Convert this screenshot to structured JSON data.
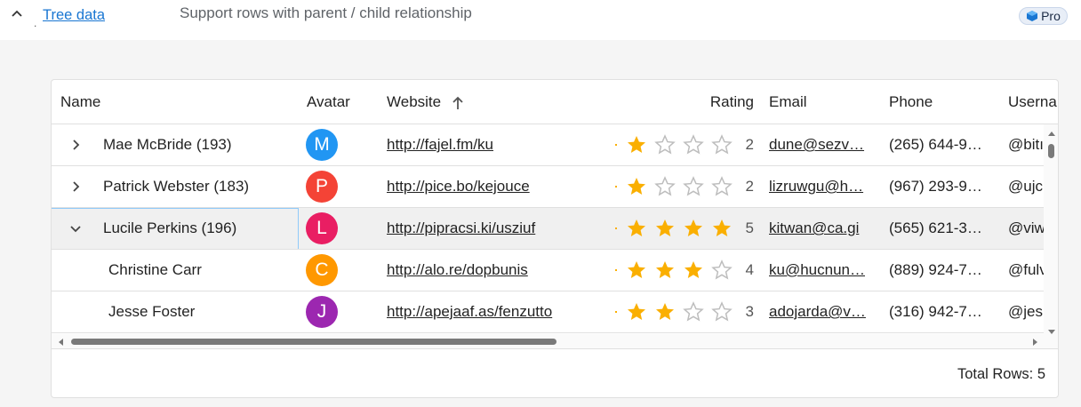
{
  "demo": {
    "marker": ".",
    "title": "Tree data",
    "description": "Support rows with parent / child relationship",
    "badge": "Pro"
  },
  "colors": {
    "link": "#1976d2",
    "star_filled": "#faaf00",
    "star_empty": "#bdbdbd"
  },
  "grid": {
    "columns": [
      {
        "key": "name",
        "label": "Name"
      },
      {
        "key": "avatar",
        "label": "Avatar"
      },
      {
        "key": "website",
        "label": "Website",
        "sort": "ascending"
      },
      {
        "key": "rating",
        "label": "Rating"
      },
      {
        "key": "email",
        "label": "Email"
      },
      {
        "key": "phone",
        "label": "Phone"
      },
      {
        "key": "username",
        "label": "Userna"
      }
    ],
    "rows": [
      {
        "name": "Mae McBride (193)",
        "expander": "chevron-right-icon",
        "avatar": "M",
        "avatar_color": "#2196f3",
        "website": "http://fajel.fm/ku",
        "rating": 1,
        "rating_label": "2",
        "email": "dune@sezv…",
        "phone": "(265) 644-9…",
        "username": "@bitı"
      },
      {
        "name": "Patrick Webster (183)",
        "expander": "chevron-right-icon",
        "avatar": "P",
        "avatar_color": "#f44336",
        "website": "http://pice.bo/kejouce",
        "rating": 1,
        "rating_label": "2",
        "email": "lizruwgu@h…",
        "phone": "(967) 293-9…",
        "username": "@ujc"
      },
      {
        "name": "Lucile Perkins (196)",
        "expander": "chevron-down-icon",
        "avatar": "L",
        "avatar_color": "#e91e63",
        "website": "http://pipracsi.ki/usziuf",
        "rating": 4,
        "rating_label": "5",
        "email": "kitwan@ca.gi",
        "phone": "(565) 621-3…",
        "username": "@viw",
        "selected": true
      },
      {
        "name": "Christine Carr",
        "avatar": "C",
        "avatar_color": "#ff9800",
        "website": "http://alo.re/dopbunis",
        "rating": 3,
        "rating_label": "4",
        "email": "ku@hucnun…",
        "phone": "(889) 924-7…",
        "username": "@fulv",
        "child": true
      },
      {
        "name": "Jesse Foster",
        "avatar": "J",
        "avatar_color": "#9c27b0",
        "website": "http://apejaaf.as/fenzutto",
        "rating": 2,
        "rating_label": "3",
        "email": "adojarda@v…",
        "phone": "(316) 942-7…",
        "username": "@jes",
        "child": true
      }
    ],
    "footer": {
      "total_rows": "Total Rows: 5"
    }
  }
}
